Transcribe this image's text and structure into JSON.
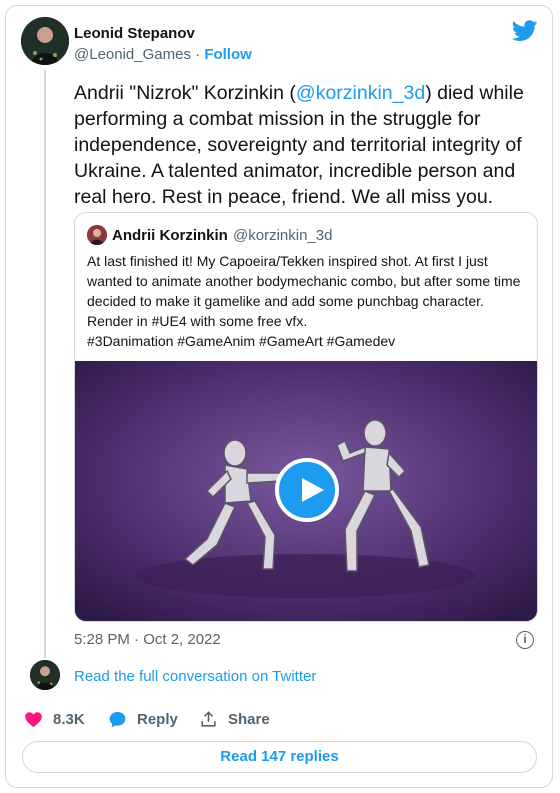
{
  "author": {
    "name": "Leonid Stepanov",
    "handle": "@Leonid_Games",
    "separator": "·",
    "follow": "Follow"
  },
  "tweet": {
    "text_before": "Andrii \"Nizrok\" Korzinkin (",
    "mention": "@korzinkin_3d",
    "text_after": ") died while performing a combat mission in the struggle for independence, sovereignty and territorial integrity of Ukraine. A talented animator, incredible person and real hero. Rest in peace, friend. We all miss you."
  },
  "quoted": {
    "name": "Andrii Korzinkin",
    "handle": "@korzinkin_3d",
    "text": "At last finished it! My Capoeira/Tekken inspired shot. At first I just wanted to animate another bodymechanic combo, but after some time decided to make it gamelike and add some punchbag character. Render in #UE4 with some free vfx.",
    "hashtags": "#3Danimation #GameAnim #GameArt #Gamedev"
  },
  "timestamp": "5:28 PM · Oct 2, 2022",
  "read_full": "Read the full conversation on Twitter",
  "actions": {
    "likes": "8.3K",
    "reply": "Reply",
    "share": "Share"
  },
  "read_replies": "Read 147 replies",
  "colors": {
    "accent": "#1d9bf0",
    "like": "#f91880",
    "muted": "#536471"
  }
}
